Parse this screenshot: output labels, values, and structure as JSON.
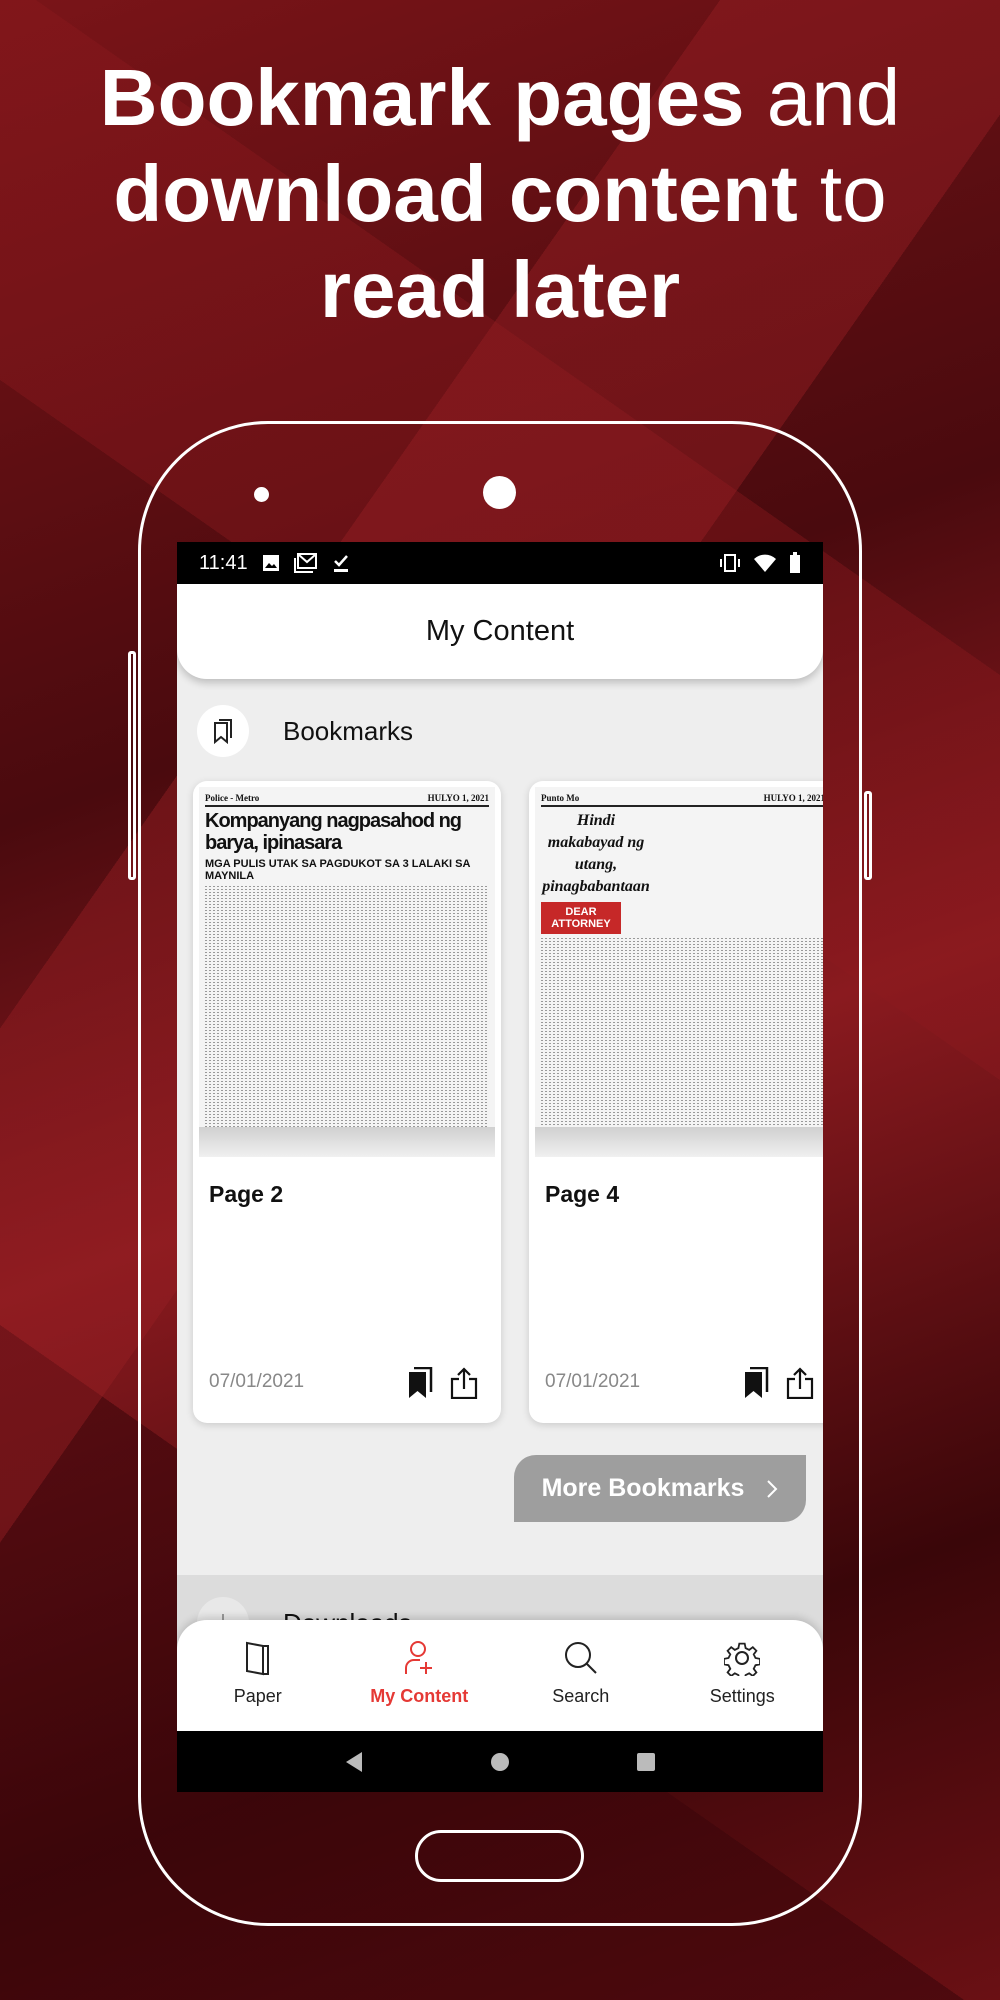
{
  "headline": {
    "line1_bold": "Bookmark pages",
    "line1_rest": " and",
    "line2_bold": "download content",
    "line2_rest": " to",
    "line3_bold": "read later"
  },
  "status": {
    "time": "11:41"
  },
  "header": {
    "title": "My Content"
  },
  "bookmarks": {
    "title": "Bookmarks",
    "more_label": "More Bookmarks",
    "items": [
      {
        "label": "Page 2",
        "date": "07/01/2021",
        "np_section": "Police - Metro",
        "np_date": "HULYO 1, 2021",
        "np_headline": "Kompanyang nagpasahod ng barya, ipinasara",
        "np_sub": "MGA PULIS UTAK SA PAGDUKOT SA 3 LALAKI SA MAYNILA"
      },
      {
        "label": "Page 4",
        "date": "07/01/2021",
        "np_section": "Punto Mo",
        "np_date": "HULYO 1, 2021",
        "np_headline": "Hindi makabayad ng utang, pinagbabantaan",
        "np_sub": "DEAR ATTORNEY"
      }
    ]
  },
  "downloads": {
    "title": "Downloads"
  },
  "nav": {
    "items": [
      {
        "label": "Paper",
        "icon": "paper-icon"
      },
      {
        "label": "My Content",
        "icon": "user-add-icon",
        "active": true
      },
      {
        "label": "Search",
        "icon": "search-icon"
      },
      {
        "label": "Settings",
        "icon": "gear-icon"
      }
    ]
  },
  "colors": {
    "accent": "#e53935",
    "more_button": "#9e9e9e"
  }
}
